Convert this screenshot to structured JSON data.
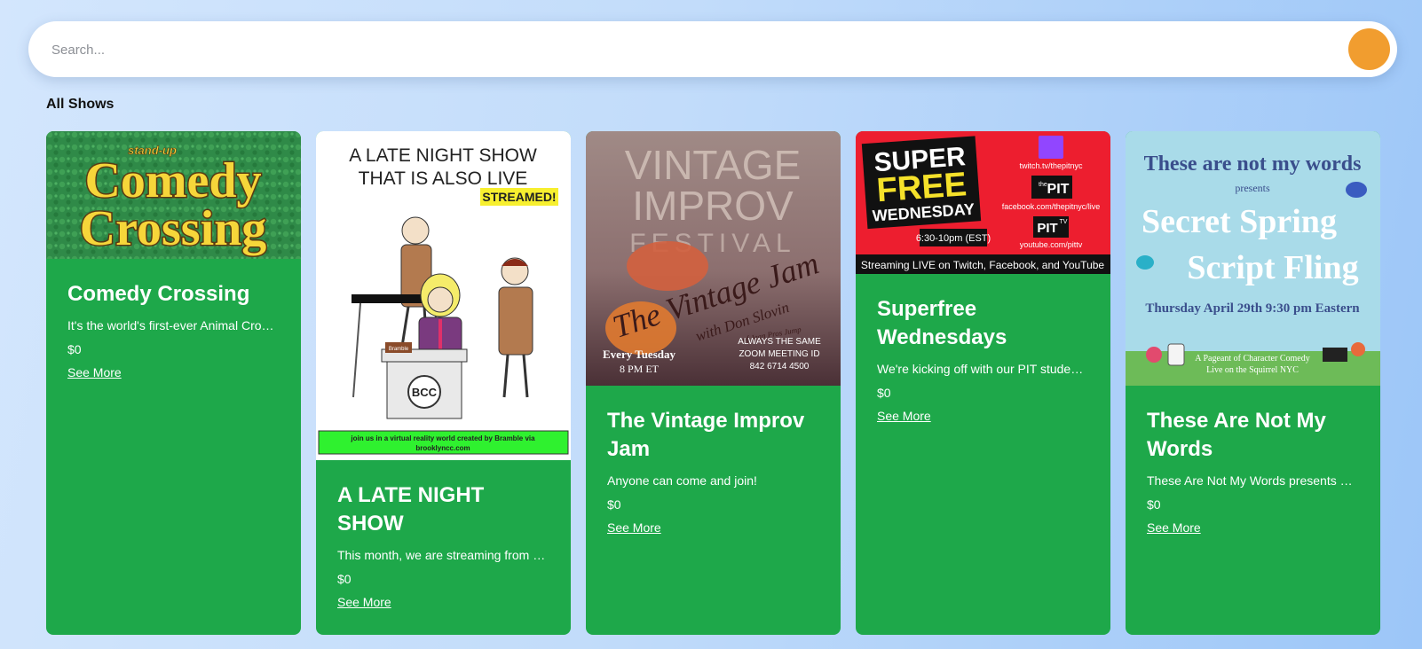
{
  "search": {
    "placeholder": "Search..."
  },
  "section_title": "All Shows",
  "colors": {
    "card_bg": "#1ea84a",
    "accent": "#f19d2f"
  },
  "shows": [
    {
      "title": "Comedy Crossing",
      "description": "It's the world's first-ever Animal Crossing stand-up comedy show!",
      "price": "$0",
      "link": "See More",
      "poster": {
        "tag": "stand-up",
        "line1": "Comedy",
        "line2": "Crossing"
      }
    },
    {
      "title": "A LATE NIGHT SHOW",
      "description": "This month, we are streaming from a virtual reality world!",
      "price": "$0",
      "link": "See More",
      "poster": {
        "line1": "A LATE NIGHT SHOW",
        "line2": "THAT IS ALSO LIVE",
        "badge": "STREAMED!",
        "desk_logo": "BCC",
        "desk_tag": "Bramble",
        "footer1": "join us in a virtual reality world created by Bramble via",
        "footer2": "brooklyncc.com"
      }
    },
    {
      "title": "The Vintage Improv Jam",
      "description": "Anyone can come and join!",
      "price": "$0",
      "link": "See More",
      "poster": {
        "bg1": "VINTAGE",
        "bg2": "IMPROV",
        "bg3": "FESTIVAL",
        "script1": "The Vintage Jam",
        "script2": "with Don Slovin",
        "script3": "of Jean Pros Jump",
        "day": "Every Tuesday",
        "time": "8 PM ET",
        "zoom1": "ALWAYS THE SAME",
        "zoom2": "ZOOM MEETING ID",
        "zoom3": "842 6714 4500"
      }
    },
    {
      "title": "Superfree Wednesdays",
      "description": "We're kicking off with our PIT student showcase every Wednesday night!",
      "price": "$0",
      "link": "See More",
      "poster": {
        "w1": "SUPER",
        "w2": "FREE",
        "w3": "WEDNESDAY",
        "time": "6:30-10pm (EST)",
        "twitch": "twitch.tv/thepitnyc",
        "pit": "PIT",
        "the": "the",
        "facebook": "facebook.com/thepitnyc/live",
        "pittv": "PIT",
        "tv": "TV",
        "youtube": "youtube.com/pittv",
        "streaming": "Streaming LIVE on Twitch, Facebook, and YouTube"
      }
    },
    {
      "title": "These Are Not My Words",
      "description": "These Are Not My Words presents Secret Spring Script Fling",
      "price": "$0",
      "link": "See More",
      "poster": {
        "top": "These are not my words",
        "presents": "presents",
        "line1": "Secret Spring",
        "line2": "Script Fling",
        "date": "Thursday April 29th 9:30 pm Eastern",
        "foot1": "A Pageant of Character Comedy",
        "foot2": "Live on the Squirrel NYC"
      }
    }
  ]
}
